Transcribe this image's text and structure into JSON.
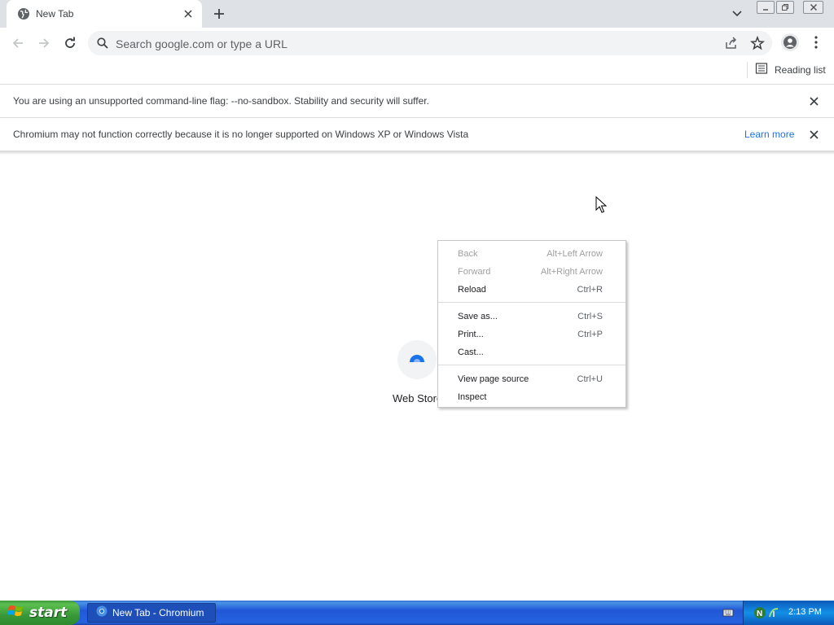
{
  "browser": {
    "tab_title": "New Tab",
    "omnibox_placeholder": "Search google.com or type a URL",
    "reading_list_label": "Reading list"
  },
  "infobars": [
    {
      "text": "You are using an unsupported command-line flag: --no-sandbox. Stability and security will suffer."
    },
    {
      "text": "Chromium may not function correctly because it is no longer supported on Windows XP or Windows Vista",
      "link": "Learn more"
    }
  ],
  "shortcut": {
    "label": "Web Store"
  },
  "context_menu": {
    "items": [
      {
        "label": "Back",
        "accel": "Alt+Left Arrow",
        "enabled": false
      },
      {
        "label": "Forward",
        "accel": "Alt+Right Arrow",
        "enabled": false
      },
      {
        "label": "Reload",
        "accel": "Ctrl+R",
        "enabled": true
      },
      {
        "label": "Save as...",
        "accel": "Ctrl+S",
        "enabled": true
      },
      {
        "label": "Print...",
        "accel": "Ctrl+P",
        "enabled": true
      },
      {
        "label": "Cast...",
        "accel": "",
        "enabled": true
      },
      {
        "label": "View page source",
        "accel": "Ctrl+U",
        "enabled": true
      },
      {
        "label": "Inspect",
        "accel": "",
        "enabled": true
      }
    ]
  },
  "taskbar": {
    "start_label": "start",
    "task_label": "New Tab - Chromium",
    "clock": "2:13 PM"
  },
  "icons": [
    "globe-icon",
    "close-icon",
    "plus-icon",
    "chevron-down-icon",
    "minimize-icon",
    "restore-icon",
    "back-icon",
    "forward-icon",
    "reload-icon",
    "search-icon",
    "share-icon",
    "star-icon",
    "profile-icon",
    "menu-icon",
    "reading-list-icon",
    "webstore-icon",
    "cursor-icon",
    "windows-logo-icon",
    "chromium-icon",
    "keyboard-icon",
    "network-icon",
    "shield-icon"
  ],
  "colors": {
    "accent": "#1a73e8",
    "tabstrip": "#dee1e6",
    "taskbar": "#245edb",
    "start": "#3c9b3c"
  }
}
